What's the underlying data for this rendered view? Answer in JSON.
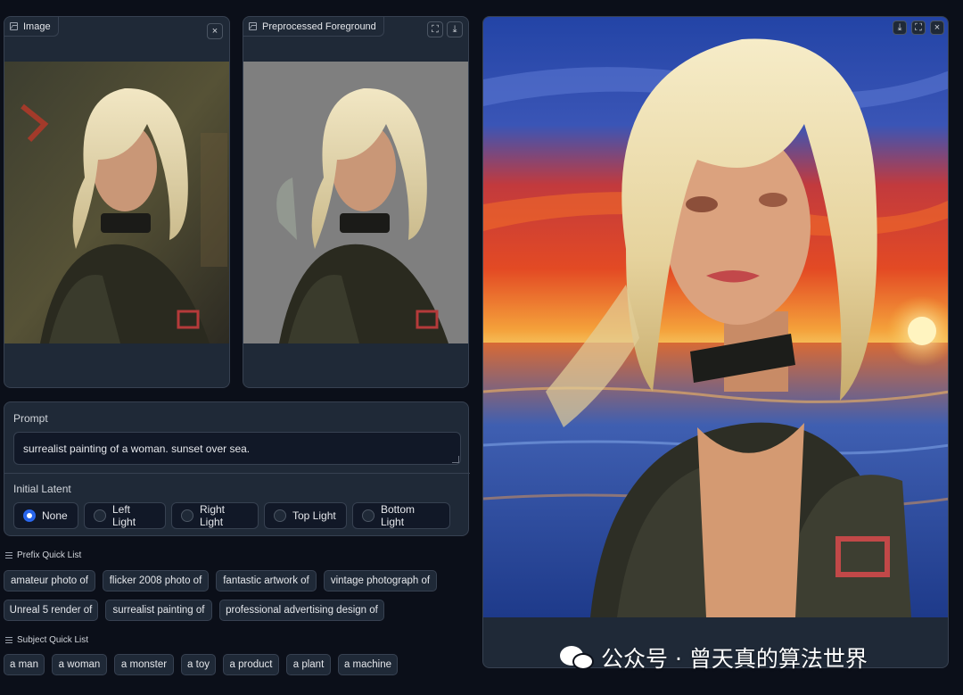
{
  "input_panel": {
    "label": "Image",
    "close_icon": "×"
  },
  "preprocessed_panel": {
    "label": "Preprocessed Foreground",
    "fullscreen_icon": "⛶",
    "download_icon": "⤓"
  },
  "output_panel": {
    "download_icon": "⤓",
    "fullscreen_icon": "⛶",
    "close_icon": "×"
  },
  "prompt": {
    "label": "Prompt",
    "value": "surrealist painting of a woman. sunset over sea."
  },
  "initial_latent": {
    "label": "Initial Latent",
    "options": [
      "None",
      "Left Light",
      "Right Light",
      "Top Light",
      "Bottom Light"
    ],
    "selected": "None"
  },
  "prefix_quick_list": {
    "title": "Prefix Quick List",
    "items": [
      "amateur photo of",
      "flicker 2008 photo of",
      "fantastic artwork of",
      "vintage photograph of",
      "Unreal 5 render of",
      "surrealist painting of",
      "professional advertising design of"
    ]
  },
  "subject_quick_list": {
    "title": "Subject Quick List",
    "items": [
      "a man",
      "a woman",
      "a monster",
      "a toy",
      "a product",
      "a plant",
      "a machine"
    ]
  },
  "watermark": {
    "text": "公众号 · 曾天真的算法世界"
  },
  "colors": {
    "background": "#0b0f19",
    "panel": "#1f2937",
    "border": "#374151",
    "accent": "#2563eb"
  }
}
